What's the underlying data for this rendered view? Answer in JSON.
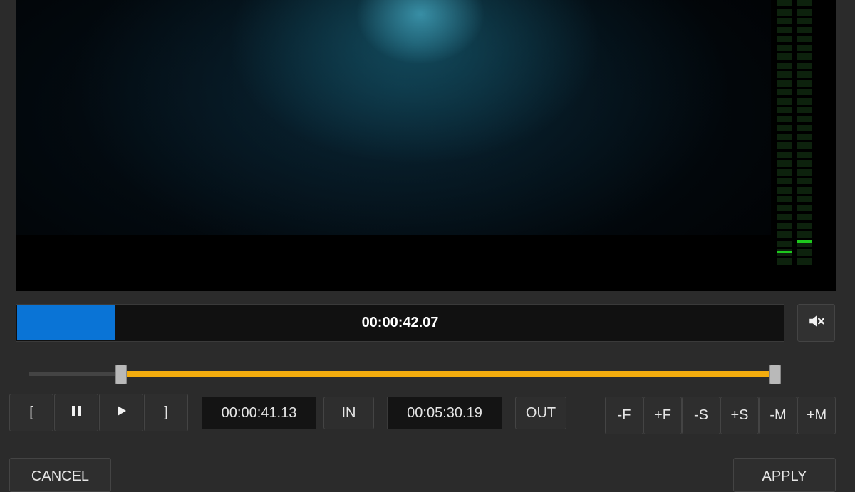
{
  "preview": {
    "meter_left_peak_percent": 6,
    "meter_right_peak_percent": 10,
    "meter_active_color": "#1ec81e",
    "meter_inactive_color": "#0d220d"
  },
  "playback": {
    "current_time": "00:00:42.07",
    "progress_percent": 12.7,
    "progress_color": "#0a74d6",
    "mute_icon": "speaker-muted-icon"
  },
  "trim": {
    "start_percent": 12.3,
    "end_percent": 99.2,
    "range_color": "#f2ac0e"
  },
  "controls": {
    "set_in_bracket_label": "[",
    "pause_icon": "pause-icon",
    "play_icon": "play-icon",
    "set_out_bracket_label": "]",
    "in_time": "00:00:41.13",
    "in_label": "IN",
    "out_time": "00:05:30.19",
    "out_label": "OUT"
  },
  "step_buttons": [
    "-F",
    "+F",
    "-S",
    "+S",
    "-M",
    "+M"
  ],
  "footer": {
    "cancel_label": "CANCEL",
    "apply_label": "APPLY"
  }
}
